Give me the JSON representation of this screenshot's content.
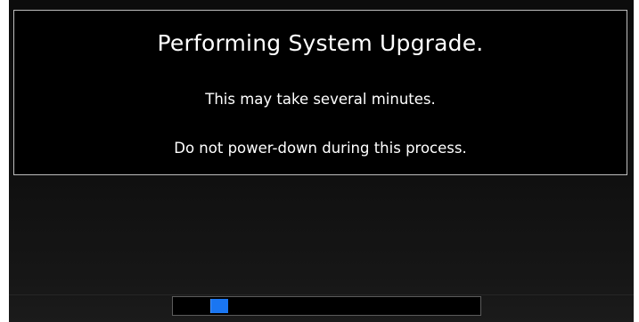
{
  "dialog": {
    "title": "Performing System Upgrade.",
    "line1": "This may take several minutes.",
    "line2": "Do not power-down during this process."
  },
  "progress": {
    "type": "indeterminate",
    "marker_position_fraction": 0.13,
    "marker_color": "#1a76f2"
  },
  "colors": {
    "background": "#000000",
    "text": "#ffffff",
    "border": "#bdbdbd"
  }
}
